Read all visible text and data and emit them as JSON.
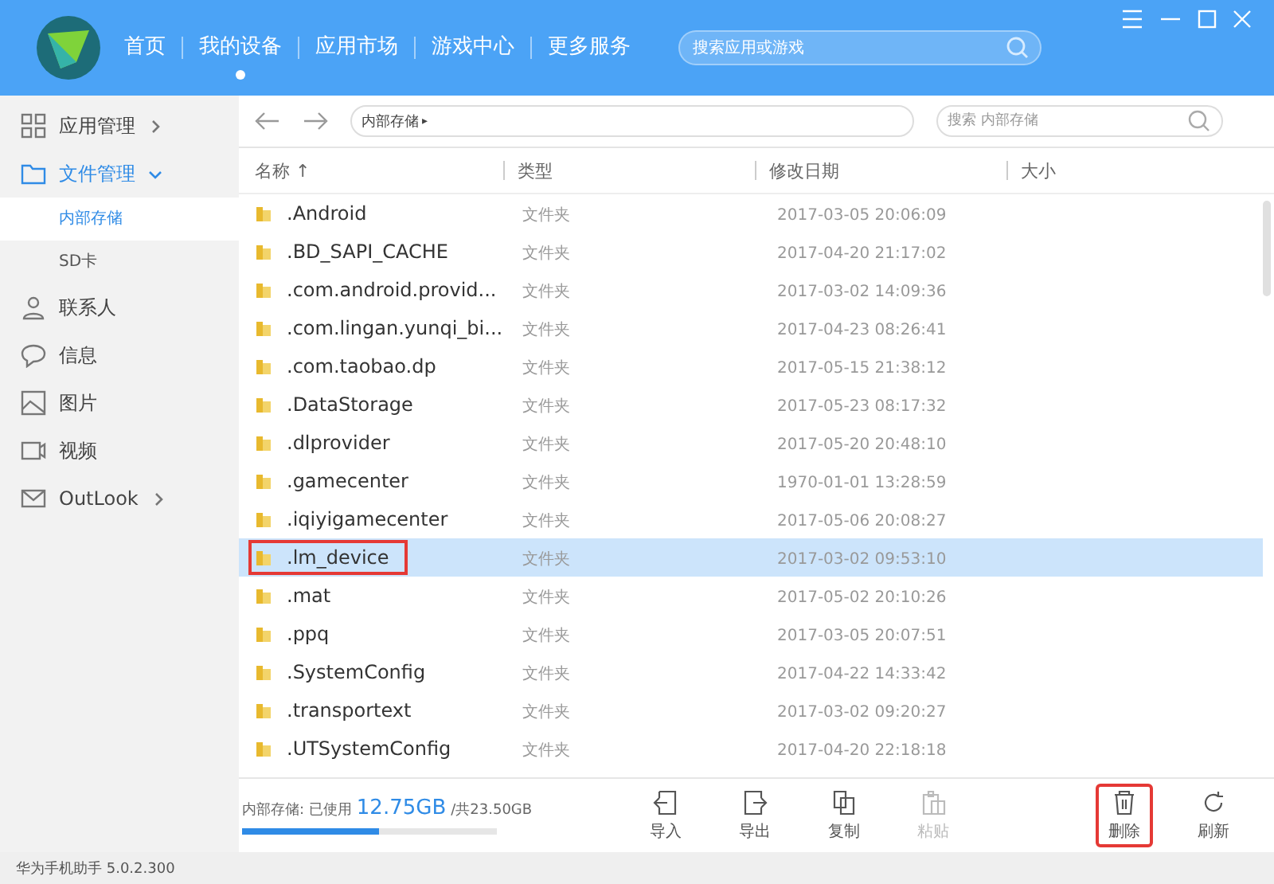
{
  "nav": [
    {
      "label": "首页",
      "selected": false
    },
    {
      "label": "我的设备",
      "selected": true
    },
    {
      "label": "应用市场",
      "selected": false
    },
    {
      "label": "游戏中心",
      "selected": false
    },
    {
      "label": "更多服务",
      "selected": false
    }
  ],
  "top_search": {
    "placeholder": "搜索应用或游戏"
  },
  "sidebar": {
    "items": [
      {
        "kind": "apps",
        "label": "应用管理",
        "expanded": false,
        "selected": false
      },
      {
        "kind": "folder",
        "label": "文件管理",
        "expanded": true,
        "selected": true,
        "children": [
          {
            "label": "内部存储",
            "selected": true
          },
          {
            "label": "SD卡",
            "selected": false
          }
        ]
      },
      {
        "kind": "contacts",
        "label": "联系人",
        "selected": false
      },
      {
        "kind": "messages",
        "label": "信息",
        "selected": false
      },
      {
        "kind": "pictures",
        "label": "图片",
        "selected": false
      },
      {
        "kind": "videos",
        "label": "视频",
        "selected": false
      },
      {
        "kind": "mail",
        "label": "OutLook",
        "expanded": false,
        "selected": false
      }
    ]
  },
  "path": {
    "crumb": "内部存储",
    "crumb_arrow": "▸",
    "search_placeholder": "搜索 内部存储"
  },
  "table": {
    "columns": [
      "名称 ↑",
      "类型",
      "修改日期",
      "大小"
    ],
    "rows": [
      {
        "name": ".Android",
        "type": "文件夹",
        "date": "2017-03-05 20:06:09",
        "selected": false,
        "annotated": false
      },
      {
        "name": ".BD_SAPI_CACHE",
        "type": "文件夹",
        "date": "2017-04-20 21:17:02",
        "selected": false,
        "annotated": false
      },
      {
        "name": ".com.android.provid...",
        "type": "文件夹",
        "date": "2017-03-02 14:09:36",
        "selected": false,
        "annotated": false
      },
      {
        "name": ".com.lingan.yunqi_bi...",
        "type": "文件夹",
        "date": "2017-04-23 08:26:41",
        "selected": false,
        "annotated": false
      },
      {
        "name": ".com.taobao.dp",
        "type": "文件夹",
        "date": "2017-05-15 21:38:12",
        "selected": false,
        "annotated": false
      },
      {
        "name": ".DataStorage",
        "type": "文件夹",
        "date": "2017-05-23 08:17:32",
        "selected": false,
        "annotated": false
      },
      {
        "name": ".dlprovider",
        "type": "文件夹",
        "date": "2017-05-20 20:48:10",
        "selected": false,
        "annotated": false
      },
      {
        "name": ".gamecenter",
        "type": "文件夹",
        "date": "1970-01-01 13:28:59",
        "selected": false,
        "annotated": false
      },
      {
        "name": ".iqiyigamecenter",
        "type": "文件夹",
        "date": "2017-05-06 20:08:27",
        "selected": false,
        "annotated": false
      },
      {
        "name": ".lm_device",
        "type": "文件夹",
        "date": "2017-03-02 09:53:10",
        "selected": true,
        "annotated": true
      },
      {
        "name": ".mat",
        "type": "文件夹",
        "date": "2017-05-02 20:10:26",
        "selected": false,
        "annotated": false
      },
      {
        "name": ".ppq",
        "type": "文件夹",
        "date": "2017-03-05 20:07:51",
        "selected": false,
        "annotated": false
      },
      {
        "name": ".SystemConfig",
        "type": "文件夹",
        "date": "2017-04-22 14:33:42",
        "selected": false,
        "annotated": false
      },
      {
        "name": ".transportext",
        "type": "文件夹",
        "date": "2017-03-02 09:20:27",
        "selected": false,
        "annotated": false
      },
      {
        "name": ".UTSystemConfig",
        "type": "文件夹",
        "date": "2017-04-20 22:18:18",
        "selected": false,
        "annotated": false
      }
    ]
  },
  "storage": {
    "label": "内部存储: 已使用",
    "used": "12.75GB",
    "total": "/共23.50GB",
    "level": 0.54
  },
  "actions": [
    {
      "kind": "import",
      "label": "导入",
      "disabled": false,
      "annotated": false
    },
    {
      "kind": "export",
      "label": "导出",
      "disabled": false,
      "annotated": false
    },
    {
      "kind": "copy",
      "label": "复制",
      "disabled": false,
      "annotated": false
    },
    {
      "kind": "paste",
      "label": "粘贴",
      "disabled": true,
      "annotated": false
    },
    {
      "kind": "delete",
      "label": "删除",
      "disabled": false,
      "annotated": true
    },
    {
      "kind": "refresh",
      "label": "刷新",
      "disabled": false,
      "annotated": false
    }
  ],
  "status_bar": {
    "text": "华为手机助手 5.0.2.300"
  }
}
